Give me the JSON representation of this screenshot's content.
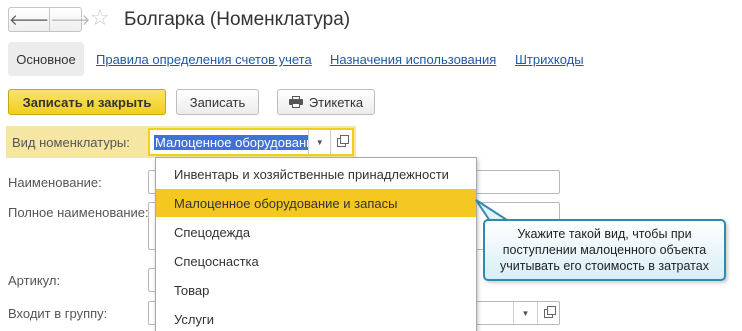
{
  "header": {
    "back_arrow": "🡐",
    "forward_arrow": "🡒",
    "star": "☆",
    "title": "Болгарка (Номенклатура)"
  },
  "tabs": [
    {
      "label": "Основное",
      "active": true
    },
    {
      "label": "Правила определения счетов учета"
    },
    {
      "label": "Назначения использования"
    },
    {
      "label": "Штрихкоды"
    }
  ],
  "toolbar": {
    "save_close_label": "Записать и закрыть",
    "save_label": "Записать",
    "label_label": "Этикетка"
  },
  "form": {
    "vid_label": "Вид номенклатуры:",
    "vid_value": "Малоценное оборудовани",
    "vid_dropdown_arrow": "▼",
    "name_label": "Наименование:",
    "full_name_label": "Полное наименование:",
    "article_label": "Артикул:",
    "group_label": "Входит в группу:",
    "group_dropdown_arrow": "▼"
  },
  "dropdown": {
    "items": [
      "Инвентарь и хозяйственные принадлежности",
      "Малоценное оборудование и запасы",
      "Спецодежда",
      "Спецоснастка",
      "Товар",
      "Услуги"
    ],
    "selected_index": 1
  },
  "callout": {
    "text": "Укажите такой вид, чтобы при поступлении малоценного объекта учитывать его стоимость в затратах"
  },
  "colors": {
    "accent_yellow": "#f1cf1d",
    "selected_item": "#f5c723",
    "link_blue": "#1c5aa5",
    "callout_border": "#2d8bb0"
  }
}
